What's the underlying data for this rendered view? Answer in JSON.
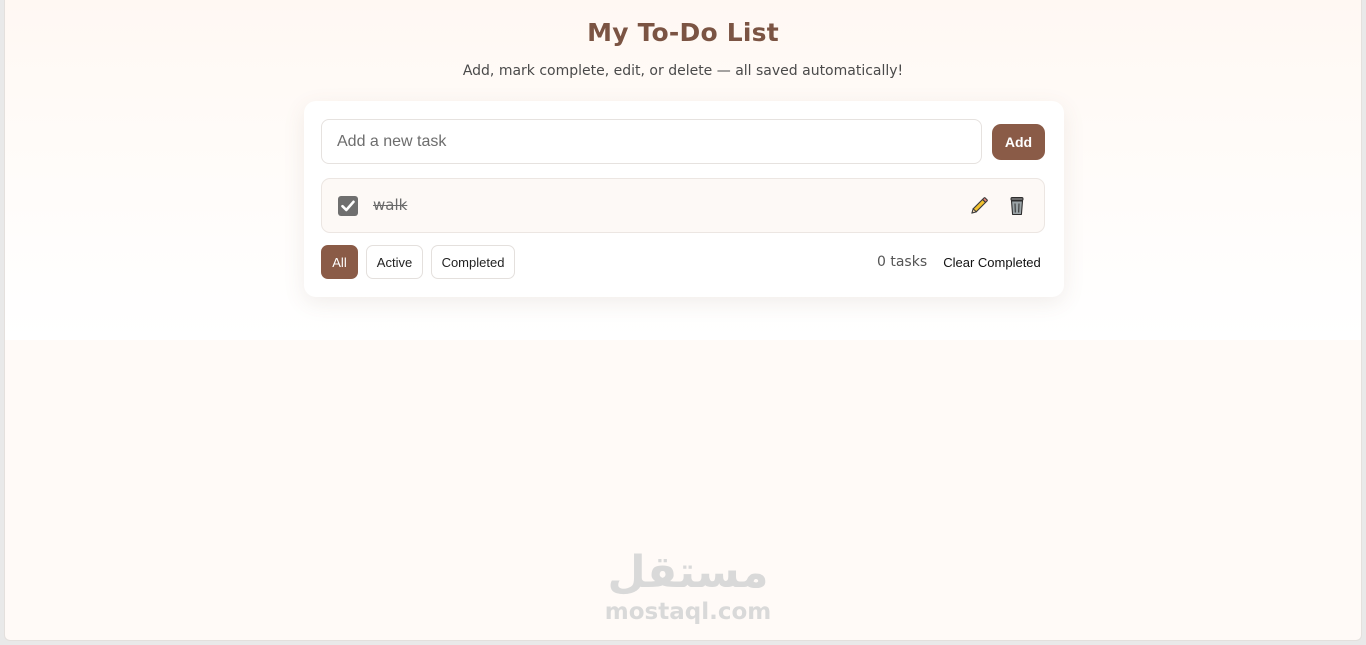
{
  "header": {
    "title": "My To-Do List",
    "subtitle": "Add, mark complete, edit, or delete — all saved automatically!"
  },
  "new_task": {
    "placeholder": "Add a new task",
    "value": "",
    "add_label": "Add"
  },
  "tasks": [
    {
      "text": "walk",
      "completed": true,
      "edit_icon": "pencil-icon",
      "delete_icon": "trash-icon"
    }
  ],
  "filters": [
    {
      "label": "All",
      "active": true
    },
    {
      "label": "Active",
      "active": false
    },
    {
      "label": "Completed",
      "active": false
    }
  ],
  "footer": {
    "count_text": "0 tasks",
    "clear_label": "Clear Completed"
  },
  "watermark": {
    "arabic": "مستقل",
    "latin": "mostaql.com"
  },
  "colors": {
    "accent": "#8a5b47",
    "title": "#7b5443",
    "page_background": "#fffaf7"
  }
}
